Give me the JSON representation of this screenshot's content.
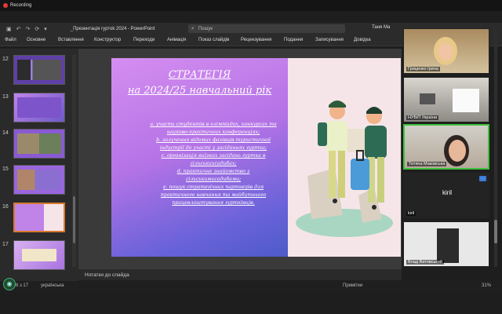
{
  "recording": {
    "label": "Recording"
  },
  "titlebar": {
    "icons": [
      "save-icon",
      "undo-icon",
      "redo-icon",
      "refresh-icon",
      "more-icon"
    ],
    "doc_title": "_Презентація гуртоk 2024  -  PowerPoint",
    "search_placeholder": "Пошук",
    "user": "Таня Ма"
  },
  "ribbon": {
    "tabs": [
      "Файл",
      "Основне",
      "Вставлення",
      "Конструктор",
      "Переходи",
      "Анімація",
      "Показ слайдів",
      "Рецензування",
      "Подання",
      "Записування",
      "Довідка"
    ]
  },
  "thumbnails": {
    "numbers": [
      "12",
      "13",
      "14",
      "15",
      "16",
      "17"
    ],
    "selected": "16"
  },
  "slide": {
    "title_line1": "СТРАТЕГІЯ",
    "title_line2": "на 2024/25 навчальний рік",
    "items": [
      "a.  участь студентів в олімпіадах, конкурсах та",
      "науково-практичних конференціях;",
      "b.  залучення відомих фахівців туристичної",
      "індустрії до участі у засіданнях гуртка;",
      "c.  організація виїзних засідань гуртка в",
      "сільськихсадибах;",
      "d.  практичне знайомство з",
      "сільськимисадибами;",
      "e.  пошук стратегічних партнерів для",
      "практичного навчання та майбутнього",
      "працевлаштування гуртківців."
    ]
  },
  "notes": {
    "label": "Нотатки до слайда"
  },
  "status": {
    "slide_count": "6 з 17",
    "language": "українська",
    "notes_btn": "Примітки",
    "zoom": "31%"
  },
  "participants": [
    {
      "name": "Гриценко Ірина"
    },
    {
      "name": "НУБіП України"
    },
    {
      "name": "Тетяна Маковська"
    },
    {
      "name": "kiril",
      "label": "kiril"
    },
    {
      "name": "Влад Витовський"
    }
  ],
  "colors": {
    "accent": "#d87a2e",
    "slide_purple": "#b473e6",
    "slide_blue": "#4d5bc8",
    "speaker_border": "#3ec03e"
  }
}
